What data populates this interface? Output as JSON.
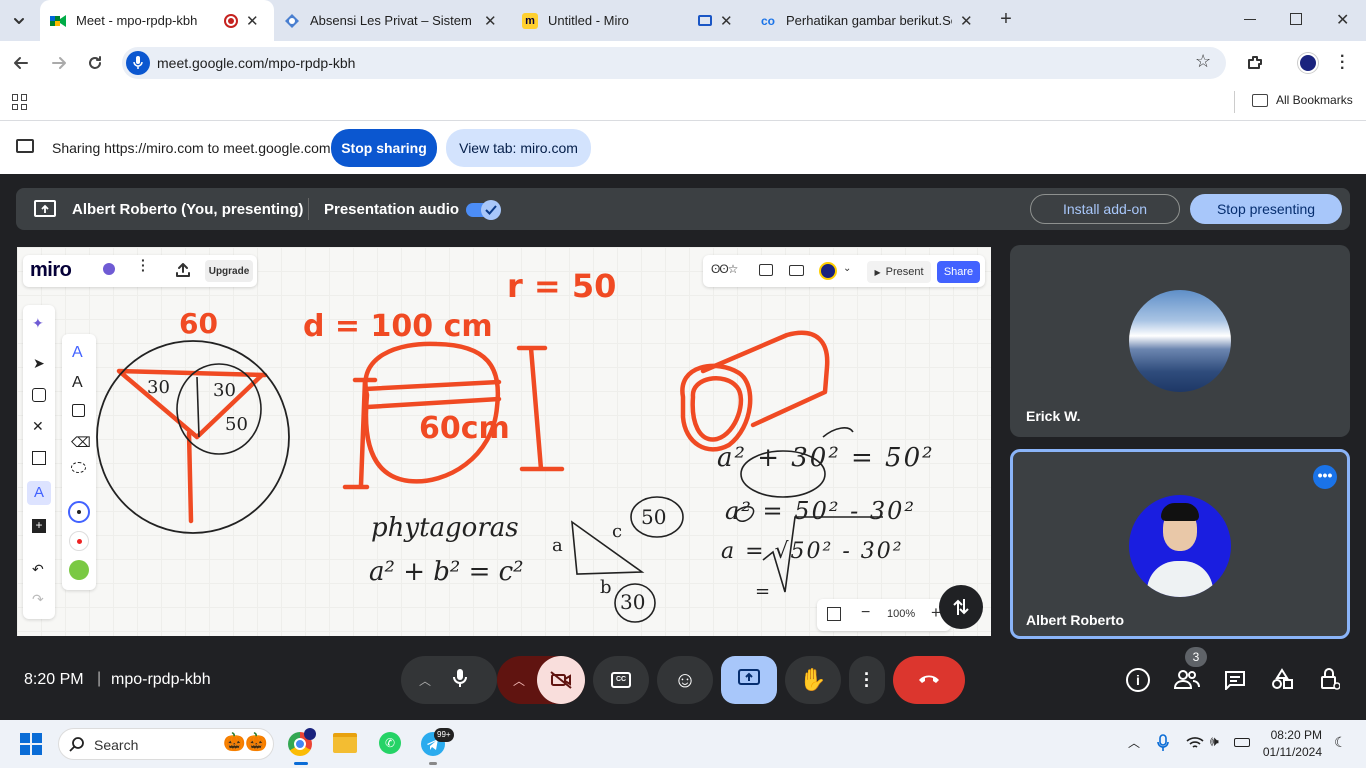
{
  "tabs": [
    {
      "title": "Meet - mpo-rpdp-kbh"
    },
    {
      "title": "Absensi Les Privat – Sistem Rua"
    },
    {
      "title": "Untitled - Miro"
    },
    {
      "title": "Perhatikan gambar berikut.Sebu"
    }
  ],
  "address": {
    "url": "meet.google.com/mpo-rpdp-kbh"
  },
  "bookmarks": {
    "all": "All Bookmarks"
  },
  "sharebar": {
    "text": "Sharing https://miro.com to meet.google.com",
    "stop": "Stop sharing",
    "view": "View tab: miro.com"
  },
  "presenting": {
    "who": "Albert Roberto (You, presenting)",
    "audio": "Presentation audio",
    "install": "Install add-on",
    "stop": "Stop presenting"
  },
  "miro": {
    "logo": "miro",
    "upgrade": "Upgrade",
    "present": "Present",
    "share": "Share",
    "zoom": "100%"
  },
  "board_text": {
    "top_label": "60",
    "d_label": "d = 100 cm",
    "r_label": "r = 50",
    "c_30a": "30",
    "c_30b": "30",
    "c_50": "50",
    "rect_60": "60cm",
    "phyt": "phytagoras",
    "formula": "a² + b² = c²",
    "tri_a": "a",
    "tri_c": "c",
    "tri_b": "b",
    "tri_50": "50",
    "tri_30": "30",
    "eq1": "a² + 30² = 50²",
    "eq2": "a² = 50² - 30²",
    "eq3": "a = √50² - 30²",
    "eq4": "="
  },
  "participants": [
    {
      "name": "Erick W."
    },
    {
      "name": "Albert Roberto"
    }
  ],
  "meeting": {
    "time": "8:20 PM",
    "code": "mpo-rpdp-kbh",
    "people_count": "3"
  },
  "taskbar": {
    "search": "Search",
    "time": "08:20 PM",
    "date": "01/11/2024",
    "badge": "99+"
  },
  "colors": {
    "accent": "#0b57d0",
    "stroke_red": "#f04a23",
    "end_call": "#dc362e"
  }
}
